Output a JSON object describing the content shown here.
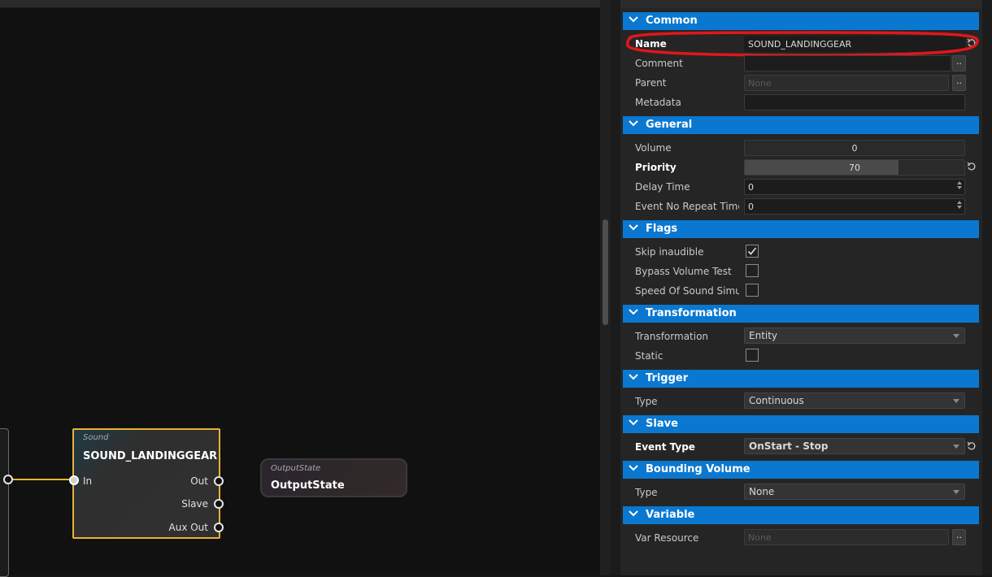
{
  "graph": {
    "sound_node": {
      "type_label": "Sound",
      "title": "SOUND_LANDINGGEAR",
      "in_label": "In",
      "out_labels": [
        "Out",
        "Slave",
        "Aux Out"
      ]
    },
    "output_node": {
      "type_label": "OutputState",
      "title": "OutputState"
    },
    "wire_color": "#e9b233"
  },
  "panel": {
    "accent": "#0a78d0",
    "highlight_color": "#e0161c",
    "sections": {
      "common": {
        "title": "Common",
        "name_label": "Name",
        "name_value": "SOUND_LANDINGGEAR",
        "comment_label": "Comment",
        "comment_value": "",
        "parent_label": "Parent",
        "parent_placeholder": "None",
        "metadata_label": "Metadata",
        "metadata_value": "",
        "browse_label": ".."
      },
      "general": {
        "title": "General",
        "volume_label": "Volume",
        "volume_value": "0",
        "priority_label": "Priority",
        "priority_value": "70",
        "priority_fraction": 0.7,
        "delay_label": "Delay Time",
        "delay_value": "0",
        "repeat_label": "Event No Repeat Time",
        "repeat_value": "0"
      },
      "flags": {
        "title": "Flags",
        "skip_label": "Skip inaudible",
        "skip_checked": true,
        "bypass_label": "Bypass Volume Test",
        "bypass_checked": false,
        "speed_label": "Speed Of Sound Simulation",
        "speed_checked": false
      },
      "transformation": {
        "title": "Transformation",
        "transformation_label": "Transformation",
        "transformation_value": "Entity",
        "static_label": "Static",
        "static_checked": false
      },
      "trigger": {
        "title": "Trigger",
        "type_label": "Type",
        "type_value": "Continuous"
      },
      "slave": {
        "title": "Slave",
        "event_type_label": "Event Type",
        "event_type_value": "OnStart - Stop"
      },
      "bounding": {
        "title": "Bounding Volume",
        "type_label": "Type",
        "type_value": "None"
      },
      "variable": {
        "title": "Variable",
        "var_label": "Var Resource",
        "var_placeholder": "None",
        "browse_label": ".."
      }
    }
  }
}
